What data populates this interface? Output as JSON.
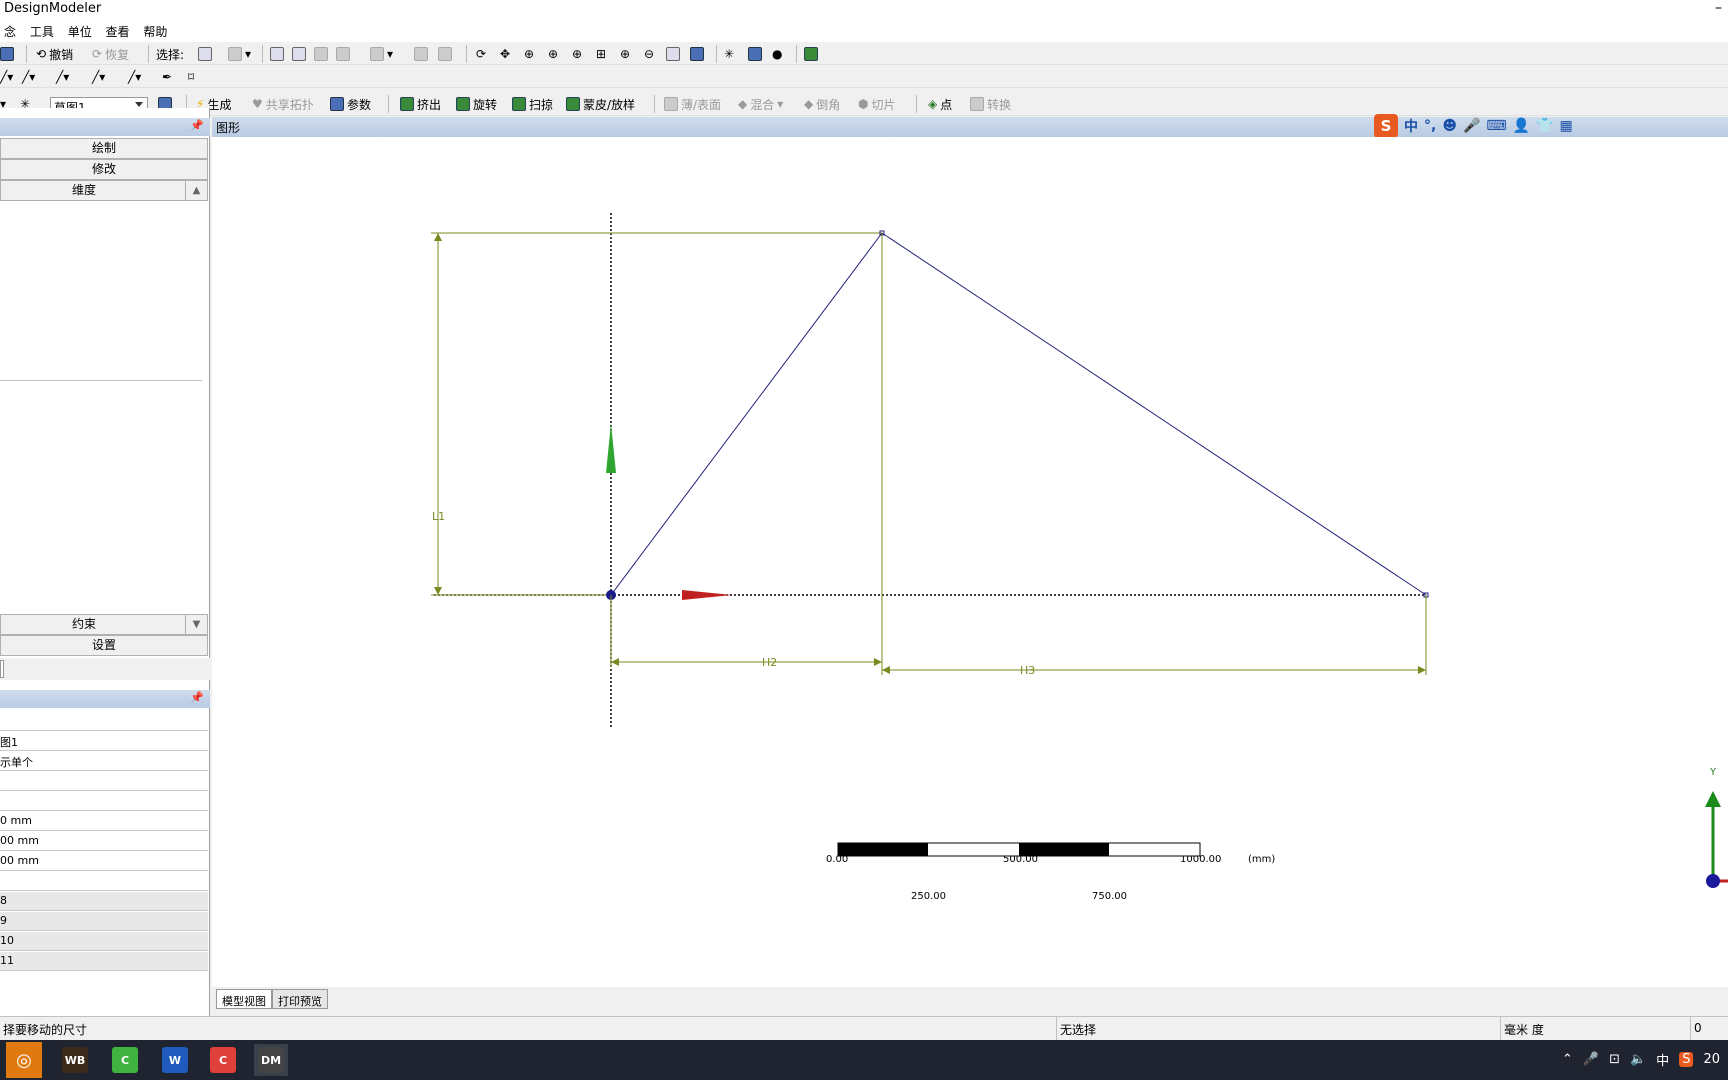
{
  "window": {
    "title": "DesignModeler",
    "minimize": "–"
  },
  "menu": [
    "念",
    "工具",
    "单位",
    "查看",
    "帮助"
  ],
  "toolbar1": {
    "undo": "撤销",
    "redo": "恢复",
    "select_label": "选择:"
  },
  "toolbar3": {
    "sketch_value": "草图1",
    "generate": "生成",
    "share_topo": "共享拓扑",
    "params": "参数",
    "extrude": "挤出",
    "revolve": "旋转",
    "sweep": "扫掠",
    "skin": "蒙皮/放样",
    "thin": "薄/表面",
    "blend": "混合",
    "chamfer": "倒角",
    "slice": "切片",
    "point": "点",
    "convert": "转换"
  },
  "sketch_toolbox": {
    "draw": "绘制",
    "modify": "修改",
    "dimensions": "维度",
    "constraints": "约束",
    "settings": "设置"
  },
  "details": {
    "rows": [
      "图1",
      "示单个",
      "",
      "",
      "0 mm",
      "00 mm",
      "00 mm",
      "",
      "8",
      "9",
      "10",
      "11"
    ]
  },
  "graphics": {
    "header": "图形",
    "dims": {
      "L1": "L1",
      "H2": "H2",
      "H3": "H3"
    },
    "scale": {
      "t0": "0.00",
      "t500": "500.00",
      "t1000": "1000.00",
      "unit": "(mm)",
      "t250": "250.00",
      "t750": "750.00"
    },
    "triad_y": "Y"
  },
  "ime": {
    "logo": "S",
    "lang": "中",
    "punct": "°,",
    "emoji": "☻",
    "mic": "🎤",
    "kbd": "⌨",
    "user": "👤",
    "shirt": "👕",
    "grid": "▦"
  },
  "tabs": {
    "model": "模型视图",
    "print": "打印预览"
  },
  "status": {
    "hint": "择要移动的尺寸",
    "selection": "无选择",
    "units": "毫米   度",
    "value": "0"
  },
  "taskbar": {
    "apps": [
      {
        "label": "",
        "color": "#e07a10"
      },
      {
        "label": "WB",
        "color": "#3b2a1a"
      },
      {
        "label": "",
        "color": "#3fb23f"
      },
      {
        "label": "W",
        "color": "#1e5bbd"
      },
      {
        "label": "",
        "color": "#e0403a"
      },
      {
        "label": "DM",
        "color": "#444"
      }
    ],
    "tray_ime": "中",
    "clock": "20"
  }
}
